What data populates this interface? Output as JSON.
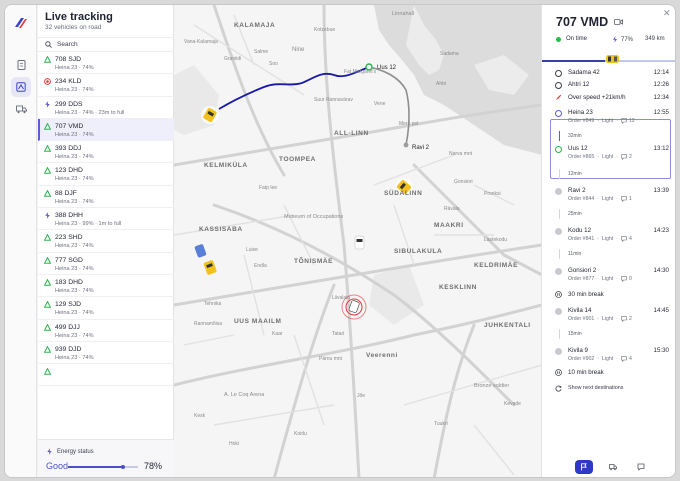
{
  "sidebar": {
    "title": "Live tracking",
    "subtitle": "32 vehicles on road",
    "search_placeholder": "Search",
    "vehicles": [
      {
        "id": "708 SJD",
        "meta": "Heina 23 · 74%",
        "icon": "triangle",
        "color": "#2db34e"
      },
      {
        "id": "234 KLD",
        "meta": "Heina 23 · 74%",
        "icon": "alert-circle",
        "color": "#e23b3b"
      },
      {
        "id": "299 DDS",
        "meta": "Heina 23 · 74% · 23m to full",
        "icon": "bolt",
        "color": "#5b5bd6"
      },
      {
        "id": "707 VMD",
        "meta": "Heina 23 · 74%",
        "icon": "triangle",
        "color": "#2db34e",
        "selected": true
      },
      {
        "id": "393 DDJ",
        "meta": "Heina 23 · 74%",
        "icon": "triangle",
        "color": "#2db34e"
      },
      {
        "id": "123 DHD",
        "meta": "Heina 23 · 74%",
        "icon": "triangle",
        "color": "#2db34e"
      },
      {
        "id": "88 DJF",
        "meta": "Heina 23 · 74%",
        "icon": "triangle",
        "color": "#2db34e"
      },
      {
        "id": "388 DHH",
        "meta": "Heina 23 · 99% · 1m to full",
        "icon": "bolt",
        "color": "#5b5bd6"
      },
      {
        "id": "223 SHD",
        "meta": "Heina 23 · 74%",
        "icon": "triangle",
        "color": "#2db34e"
      },
      {
        "id": "777 SGD",
        "meta": "Heina 23 · 74%",
        "icon": "triangle",
        "color": "#2db34e"
      },
      {
        "id": "183 DHD",
        "meta": "Heina 23 · 74%",
        "icon": "triangle",
        "color": "#2db34e"
      },
      {
        "id": "129 SJD",
        "meta": "Heina 23 · 74%",
        "icon": "triangle",
        "color": "#2db34e"
      },
      {
        "id": "499 DJJ",
        "meta": "Heina 23 · 74%",
        "icon": "triangle",
        "color": "#2db34e"
      },
      {
        "id": "939 DJD",
        "meta": "Heina 23 · 74%",
        "icon": "triangle",
        "color": "#2db34e"
      },
      {
        "id": "",
        "meta": "",
        "icon": "triangle",
        "color": "#2db34e"
      }
    ],
    "energy": {
      "label": "Energy status",
      "status": "Good",
      "percent": "78%",
      "fraction": 0.78
    }
  },
  "map": {
    "labels": [
      "KALAMAJA",
      "Linnahall",
      "Nine",
      "Vana-Kalamaja",
      "Graniidi",
      "Salme",
      "Soo",
      "Kotzebue",
      "Fat Margaret's",
      "Suur Rannavärav",
      "Vene",
      "Ahtri",
      "Sadama",
      "ALL-LINN",
      "Mere pst",
      "Ravi 2",
      "Narva mnt",
      "KELMIKÜLA",
      "TOOMPEA",
      "Gonsiori",
      "Pronksi",
      "Rävala",
      "Fatp lee",
      "SÜDALINN",
      "Museum of Occupations",
      "KASSISABA",
      "Luise",
      "Endla",
      "MAAKRI",
      "Lastekodu",
      "SIBULAKULA",
      "TÕNISMÄE",
      "KELDRIMÄE",
      "Tehnika",
      "Liivalaia",
      "KESKLINN",
      "UUS MAAILM",
      "Kaar",
      "Tatari",
      "Pärnu mnt",
      "Rannamõisa",
      "Veerenni",
      "JUHKENTALI",
      "Bronze soldier",
      "A. Le Coq Arena",
      "Kesk",
      "Koidu",
      "Hoki",
      "Jõe",
      "Tuukri",
      "Kevade"
    ],
    "route_start_label": "Uus 12",
    "route_end_label": "Ravi 2"
  },
  "detail": {
    "vehicle_id": "707 VMD",
    "status": "On time",
    "battery": "77%",
    "range": "349 km",
    "trip_progress": 0.46,
    "timeline": [
      {
        "name": "Sadama 42",
        "time": "12:14",
        "mark": "ring"
      },
      {
        "name": "Ahtri 12",
        "time": "12:26",
        "mark": "ring"
      },
      {
        "name": "Over speed +21km/h",
        "time": "12:34",
        "mark": "rocket"
      },
      {
        "name": "Heina 23",
        "time": "12:55",
        "mark": "ring-blue",
        "order": "Order #849",
        "type": "Light",
        "comments": "12"
      },
      {
        "name": "32min",
        "mark": "gap"
      },
      {
        "name": "Uus 12",
        "time": "13:12",
        "mark": "ring-green",
        "order": "Order #865",
        "type": "Light",
        "comments": "2"
      },
      {
        "name": "12min",
        "mark": "gap"
      },
      {
        "name": "Ravi 2",
        "time": "13:39",
        "mark": "fill",
        "order": "Order #844",
        "type": "Light",
        "comments": "1"
      },
      {
        "name": "25min",
        "mark": "gap"
      },
      {
        "name": "Kodu 12",
        "time": "14:23",
        "mark": "fill",
        "order": "Order #841",
        "type": "Light",
        "comments": "4"
      },
      {
        "name": "11min",
        "mark": "gap"
      },
      {
        "name": "Gonsiori 2",
        "time": "14:30",
        "mark": "fill",
        "order": "Order #877",
        "type": "Light",
        "comments": "0"
      },
      {
        "name": "30 min break",
        "mark": "pause"
      },
      {
        "name": "Kivila 14",
        "time": "14:45",
        "mark": "fill",
        "order": "Order #901",
        "type": "Light",
        "comments": "2"
      },
      {
        "name": "15min",
        "mark": "gap"
      },
      {
        "name": "Kivila 9",
        "time": "15:30",
        "mark": "fill",
        "order": "Order #902",
        "type": "Light",
        "comments": "4"
      },
      {
        "name": "10 min break",
        "mark": "pause"
      },
      {
        "name": "Show next destinations",
        "mark": "refresh"
      }
    ]
  }
}
